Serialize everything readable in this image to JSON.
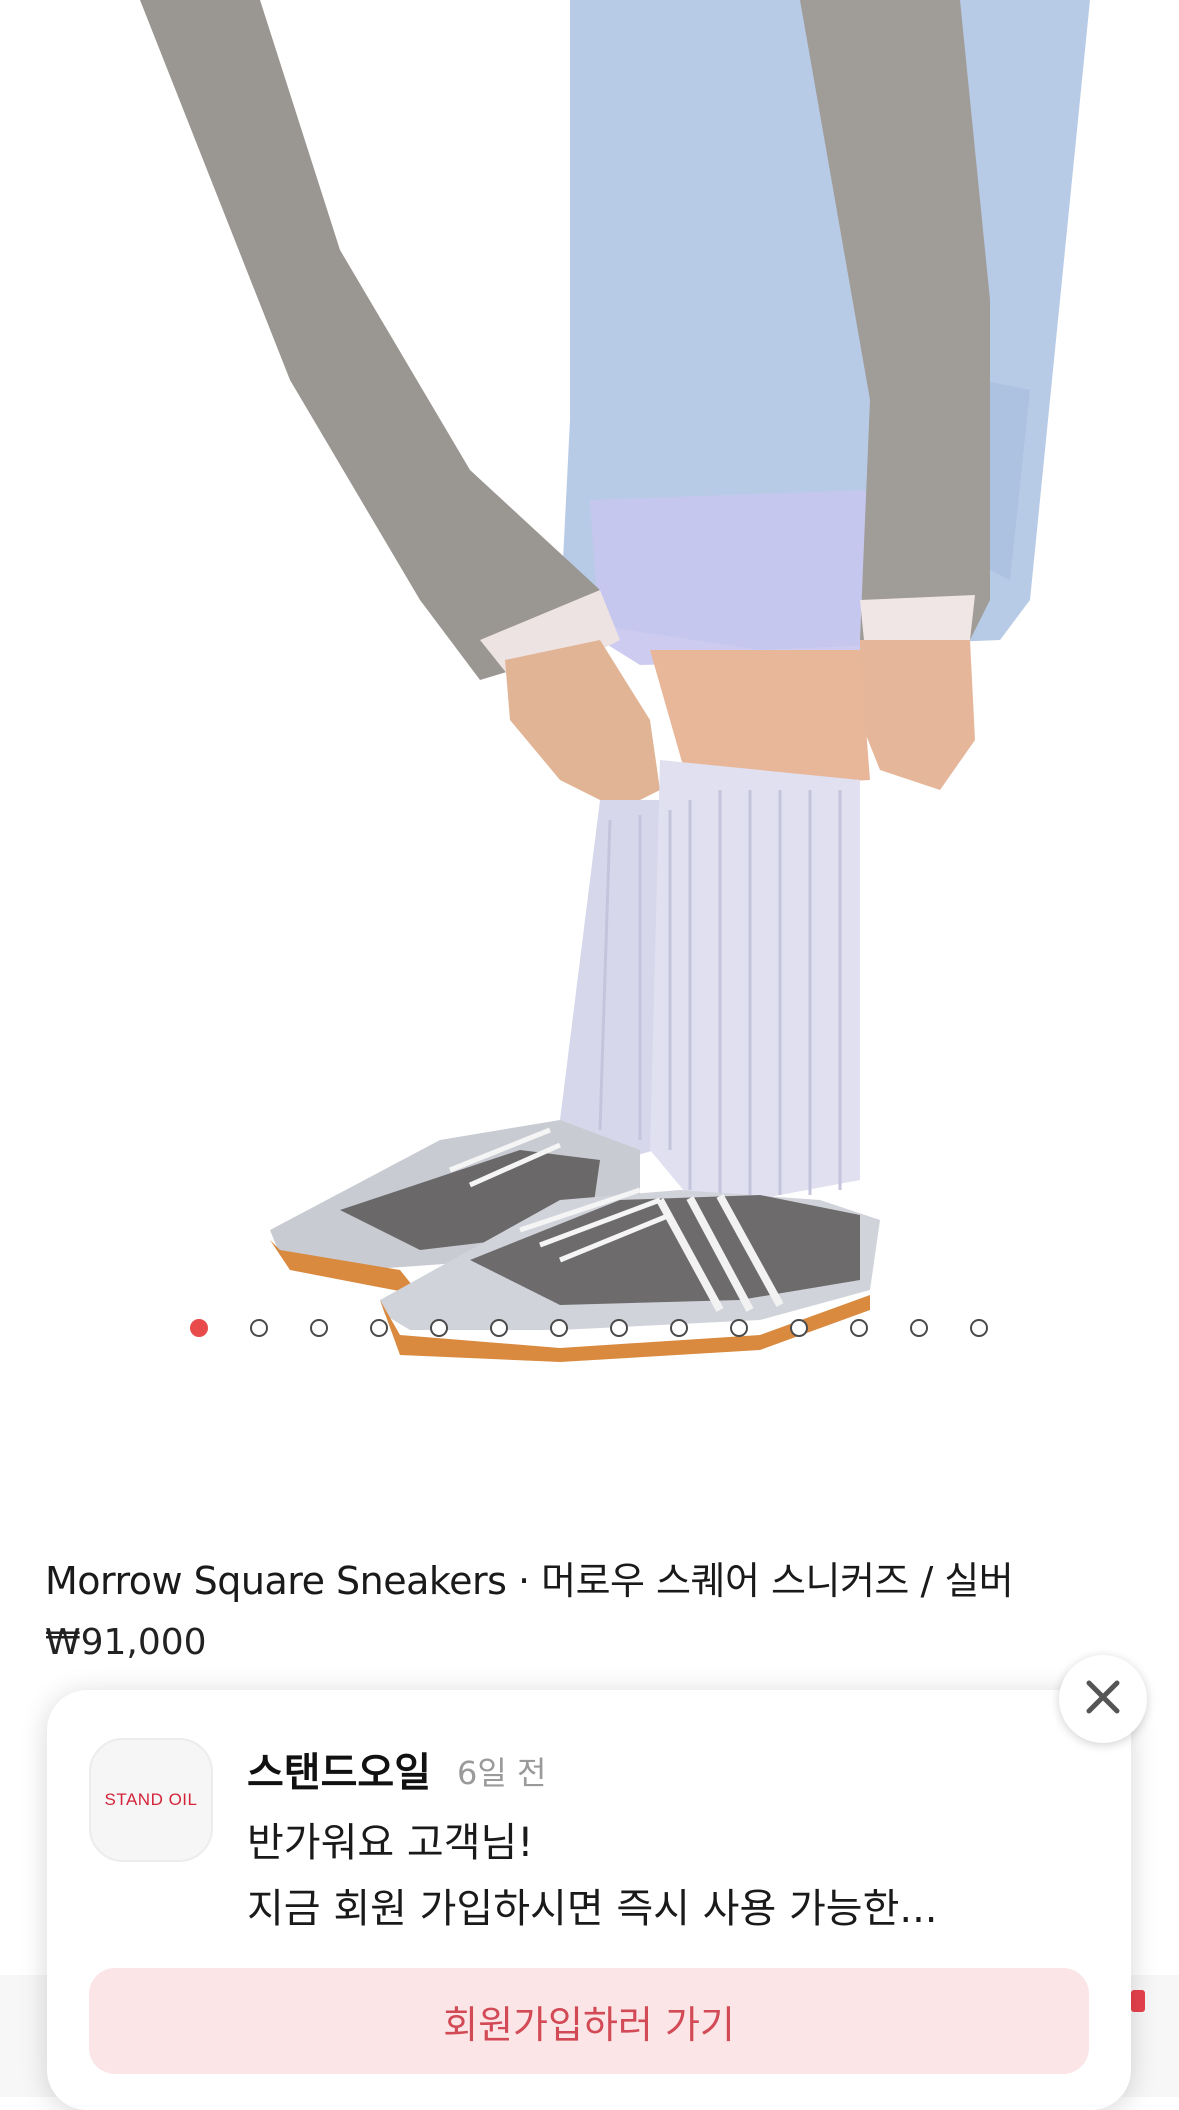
{
  "product": {
    "title": "Morrow Square Sneakers · 머로우 스퀘어 스니커즈 / 실버",
    "price": "₩91,000"
  },
  "carousel": {
    "total": 14,
    "active_index": 0,
    "active_color": "#e94a4a"
  },
  "popup": {
    "logo_text": "STAND OIL",
    "sender": "스탠드오일",
    "time": "6일 전",
    "message_line1": "반가워요 고객님!",
    "message_line2": "지금 회원 가입하시면 즉시 사용 가능한...",
    "cta_label": "회원가입하러 가기",
    "close_icon": "close-icon",
    "cta_bg": "#fbe5e6",
    "cta_color": "#d14a55"
  }
}
